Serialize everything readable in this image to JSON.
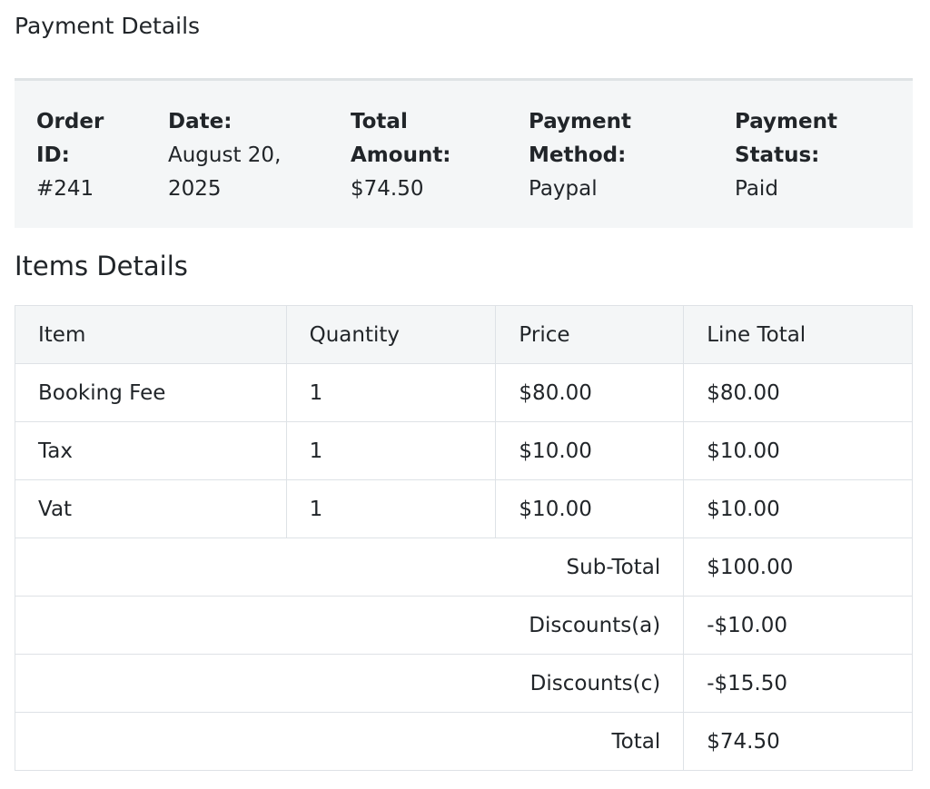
{
  "page": {
    "title": "Payment Details",
    "items_title": "Items Details"
  },
  "summary": {
    "order_id_label": "Order ID:",
    "order_id_value": "#241",
    "date_label": "Date:",
    "date_value": "August 20, 2025",
    "total_label": "Total Amount:",
    "total_value": "$74.50",
    "method_label": "Payment Method:",
    "method_value": "Paypal",
    "status_label": "Payment Status:",
    "status_value": "Paid"
  },
  "items_table": {
    "headers": [
      "Item",
      "Quantity",
      "Price",
      "Line Total"
    ],
    "rows": [
      {
        "item": "Booking Fee",
        "quantity": "1",
        "price": "$80.00",
        "line_total": "$80.00"
      },
      {
        "item": "Tax",
        "quantity": "1",
        "price": "$10.00",
        "line_total": "$10.00"
      },
      {
        "item": "Vat",
        "quantity": "1",
        "price": "$10.00",
        "line_total": "$10.00"
      }
    ],
    "totals": [
      {
        "label": "Sub-Total",
        "value": "$100.00"
      },
      {
        "label": "Discounts(a)",
        "value": "-$10.00"
      },
      {
        "label": "Discounts(c)",
        "value": "-$15.50"
      },
      {
        "label": "Total",
        "value": "$74.50"
      }
    ]
  }
}
